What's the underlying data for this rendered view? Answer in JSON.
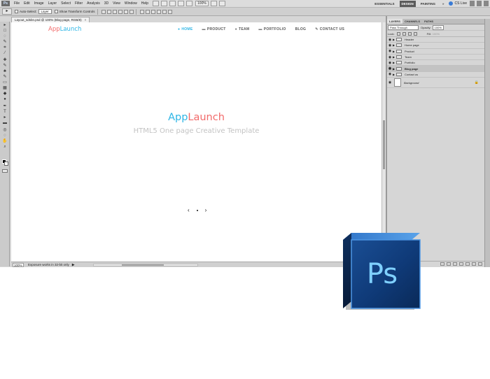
{
  "menubar": {
    "app_badge": "Ps",
    "menus": [
      "File",
      "Edit",
      "Image",
      "Layer",
      "Select",
      "Filter",
      "Analysis",
      "3D",
      "View",
      "Window",
      "Help"
    ],
    "zoom": "100%",
    "workspaces": [
      {
        "label": "ESSENTIALS",
        "active": false
      },
      {
        "label": "DESIGN",
        "active": true
      },
      {
        "label": "PAINTING",
        "active": false
      }
    ],
    "more": "»",
    "cslive": "CS Live"
  },
  "options_bar": {
    "auto_select_label": "Auto-Select:",
    "auto_select_value": "Layer",
    "transform_label": "Show Transform Controls"
  },
  "document": {
    "tab_title": "Layout_sdsbn.psd @ 100% (Blog page, RGB/8)",
    "close": "×"
  },
  "site": {
    "logo_part1": "App",
    "logo_part2": "Launch",
    "nav": [
      {
        "icon": "●",
        "label": "HOME",
        "active": true
      },
      {
        "icon": "▬",
        "label": "PRODUCT",
        "active": false
      },
      {
        "icon": "●",
        "label": "TEAM",
        "active": false
      },
      {
        "icon": "▬",
        "label": "PORTFOLIO",
        "active": false
      },
      {
        "icon": "",
        "label": "BLOG",
        "active": false
      },
      {
        "icon": "✎",
        "label": "CONTACT US",
        "active": false
      }
    ],
    "hero_title_part1": "App",
    "hero_title_part2": "Launch",
    "tagline": "HTML5 One page Creative Template",
    "slider_prev": "‹",
    "slider_next": "›"
  },
  "status_bar": {
    "zoom": "100%",
    "info": "Exposure works in 32-bit only",
    "arrow": "▶"
  },
  "layers_panel": {
    "tabs": [
      {
        "label": "LAYERS",
        "active": true
      },
      {
        "label": "CHANNELS",
        "active": false
      },
      {
        "label": "PATHS",
        "active": false
      }
    ],
    "blend_mode": "Pass Through",
    "opacity_label": "Opacity:",
    "opacity_value": "100%",
    "lock_label": "Lock:",
    "fill_label": "Fill:",
    "fill_value": "100%",
    "layers": [
      {
        "name": "Header",
        "selected": false,
        "type": "group"
      },
      {
        "name": "Home page",
        "selected": false,
        "type": "group"
      },
      {
        "name": "Product",
        "selected": false,
        "type": "group"
      },
      {
        "name": "Team",
        "selected": false,
        "type": "group"
      },
      {
        "name": "Portfolio",
        "selected": false,
        "type": "group"
      },
      {
        "name": "Blog page",
        "selected": true,
        "type": "group"
      },
      {
        "name": "Contact us",
        "selected": false,
        "type": "group"
      }
    ],
    "background_layer": "Background"
  },
  "badge": {
    "label": "Ps",
    "colors": {
      "dark": "#0a2a55",
      "mid": "#1c5aa8",
      "light": "#3d8be0",
      "text": "#7fd0ff"
    }
  }
}
